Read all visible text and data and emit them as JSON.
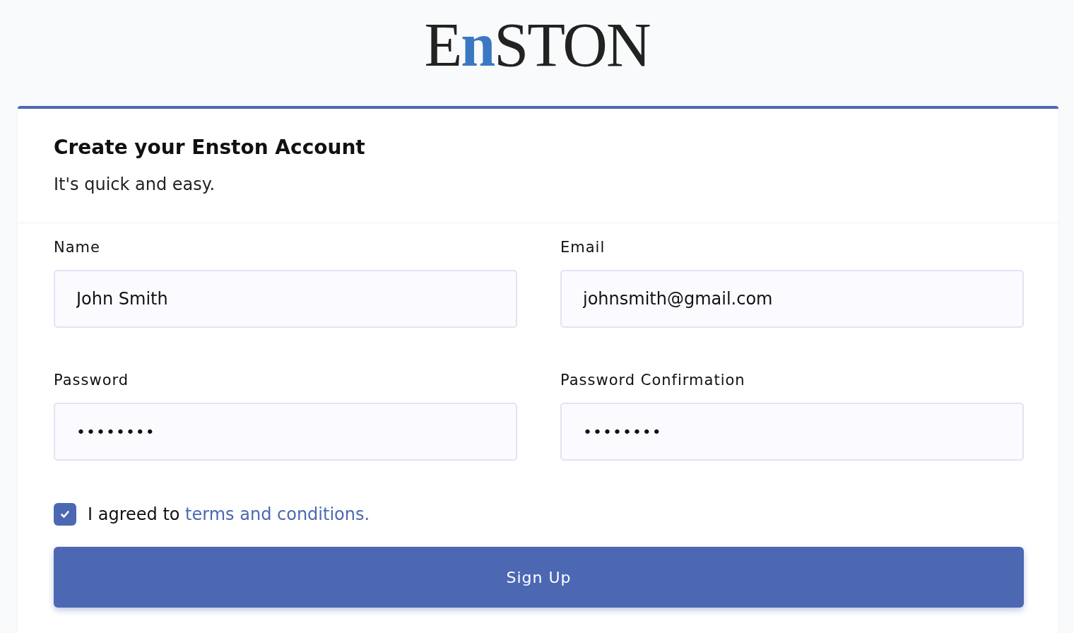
{
  "logo": {
    "parts": [
      {
        "text": "E",
        "accent": false
      },
      {
        "text": "n",
        "accent": true
      },
      {
        "text": "STON",
        "accent": false
      }
    ]
  },
  "card": {
    "title": "Create your Enston Account",
    "subtitle": "It's quick and easy.",
    "fields": [
      {
        "label": "Name",
        "value": "John Smith"
      },
      {
        "label": "Email",
        "value": "johnsmith@gmail.com"
      },
      {
        "label": "Password",
        "value": "••••••••"
      },
      {
        "label": "Password Confirmation",
        "value": "••••••••"
      }
    ],
    "agreement": {
      "checked": true,
      "text": "I agreed to",
      "link": "terms and conditions."
    },
    "submit": "Sign Up"
  }
}
